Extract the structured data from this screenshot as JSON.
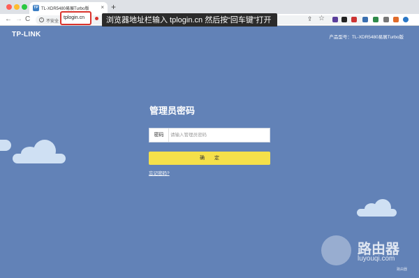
{
  "browser": {
    "tab_title": "TL-XDR5480易展Turbo版",
    "tab_favicon": "TP",
    "tab_close": "×",
    "new_tab": "+",
    "nav": {
      "back": "←",
      "forward": "→",
      "reload": "C"
    },
    "security_label": "不安全",
    "url": "tplogin.cn",
    "tooltip": "浏览器地址栏输入 tplogin.cn 然后按“回车键”打开",
    "icons": {
      "share": "share-icon",
      "star": "star-icon"
    }
  },
  "page": {
    "logo": "TP-LINK",
    "model": "产品型号：TL-XDR5480易展Turbo版",
    "title": "管理员密码",
    "password_label": "密码",
    "password_placeholder": "请输入管理员密码",
    "confirm_label": "确定",
    "forgot_label": "忘记密码?"
  },
  "watermark": {
    "name": "路由器",
    "url": "luyouqi.com",
    "corner": "路由器"
  },
  "colors": {
    "page_bg": "#6282b7",
    "button": "#f5e04a",
    "url_highlight": "#d9332c",
    "cloud": "#cfe0f3"
  }
}
